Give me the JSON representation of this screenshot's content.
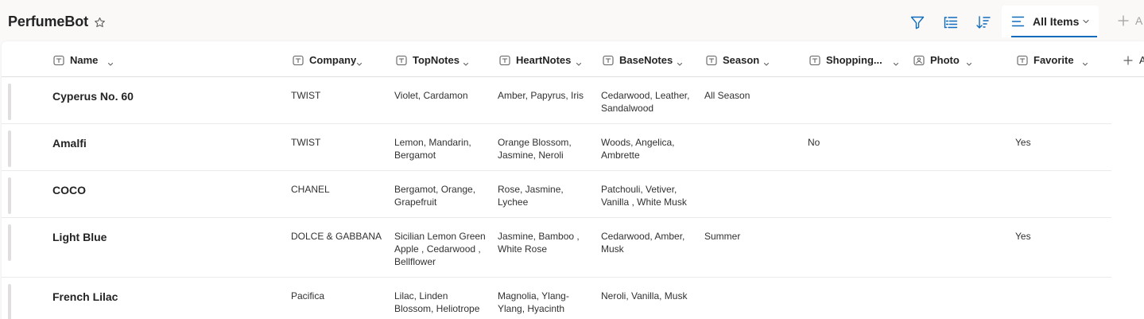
{
  "header": {
    "list_title": "PerfumeBot",
    "view_label": "All Items",
    "add_view_label": "A"
  },
  "icons": {
    "favorite": "star-outline-icon",
    "filter": "filter-icon",
    "group": "group-by-icon",
    "sort": "sort-icon",
    "view": "lines-icon",
    "add": "plus-icon",
    "column_type": "text-column-icon",
    "photo_type": "image-column-icon"
  },
  "colors": {
    "accent": "#0f6cbd",
    "page_bg": "#faf9f8",
    "grid_bg": "#ffffff"
  },
  "columns": [
    {
      "label": "Name"
    },
    {
      "label": "Company"
    },
    {
      "label": "TopNotes"
    },
    {
      "label": "HeartNotes"
    },
    {
      "label": "BaseNotes"
    },
    {
      "label": "Season"
    },
    {
      "label": "Shopping..."
    },
    {
      "label": "Photo"
    },
    {
      "label": "Favorite"
    }
  ],
  "add_column_label": "A",
  "rows": [
    {
      "name": "Cyperus No. 60",
      "company": "TWIST",
      "top": [
        "Violet, Cardamon"
      ],
      "heart": [
        "Amber, Papyrus, Iris"
      ],
      "base": [
        "Cedarwood, Leather,",
        "Sandalwood"
      ],
      "season": "All Season",
      "shopping": "",
      "favorite": ""
    },
    {
      "name": "Amalfi",
      "company": "TWIST",
      "top": [
        "Lemon, Mandarin,",
        "Bergamot"
      ],
      "heart": [
        "Orange Blossom,",
        "Jasmine, Neroli"
      ],
      "base": [
        "Woods, Angelica,",
        "Ambrette"
      ],
      "season": "",
      "shopping": "No",
      "favorite": "Yes"
    },
    {
      "name": "COCO",
      "company": "CHANEL",
      "top": [
        "Bergamot, Orange,",
        "Grapefruit"
      ],
      "heart": [
        "Rose, Jasmine,",
        "Lychee"
      ],
      "base": [
        "Patchouli, Vetiver,",
        "Vanilla , White Musk"
      ],
      "season": "",
      "shopping": "",
      "favorite": ""
    },
    {
      "name": "Light Blue",
      "company": "DOLCE & GABBANA",
      "top": [
        "Sicilian Lemon Green",
        "Apple , Cedarwood ,",
        "Bellflower"
      ],
      "heart": [
        "Jasmine, Bamboo ,",
        "White Rose"
      ],
      "base": [
        "Cedarwood, Amber,",
        "Musk"
      ],
      "season": "Summer",
      "shopping": "",
      "favorite": "Yes"
    },
    {
      "name": "French Lilac",
      "company": "Pacifica",
      "top": [
        "Lilac, Linden",
        "Blossom, Heliotrope"
      ],
      "heart": [
        "Magnolia, Ylang-",
        "Ylang, Hyacinth"
      ],
      "base": [
        "Neroli, Vanilla, Musk"
      ],
      "season": "",
      "shopping": "",
      "favorite": ""
    }
  ]
}
